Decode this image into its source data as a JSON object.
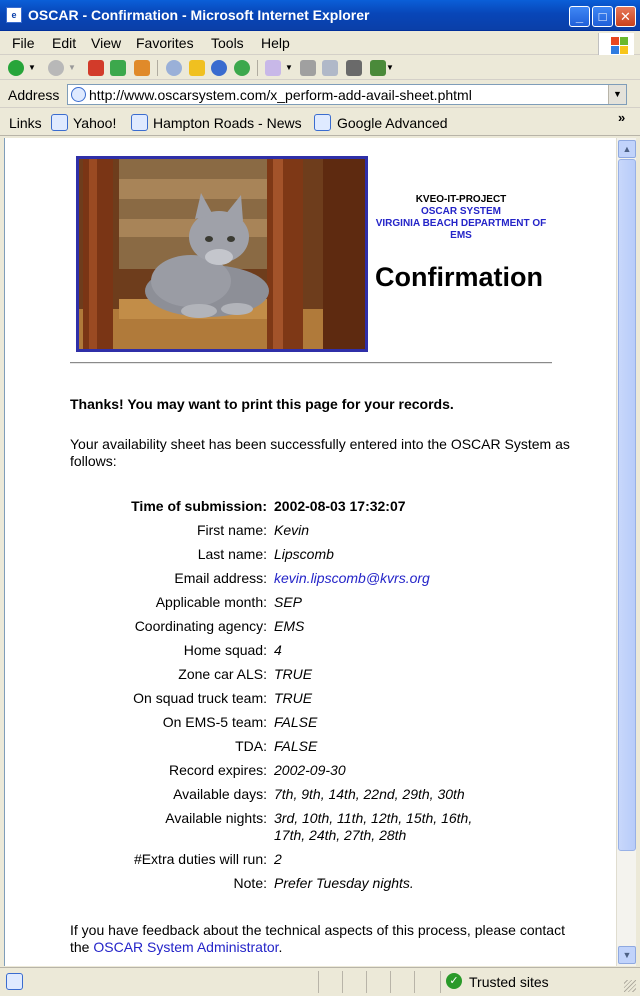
{
  "window": {
    "title": "OSCAR - Confirmation - Microsoft Internet Explorer",
    "icon": "ie-page-icon"
  },
  "menu": [
    "File",
    "Edit",
    "View",
    "Favorites",
    "Tools",
    "Help"
  ],
  "address": {
    "label": "Address",
    "url": "http://www.oscarsystem.com/x_perform-add-avail-sheet.phtml"
  },
  "links_bar": {
    "label": "Links",
    "items": [
      "Yahoo!",
      "Hampton Roads - News",
      "Google Advanced"
    ]
  },
  "page": {
    "org": {
      "line1": "KVEO-IT-PROJECT",
      "line2": "OSCAR SYSTEM",
      "line3": "VIRGINIA BEACH DEPARTMENT OF EMS"
    },
    "heading": "Confirmation",
    "thanks": "Thanks!  You may want to print this page for your records.",
    "intro": "Your availability sheet has been successfully entered into the OSCAR System as follows:",
    "details": [
      {
        "label": "Time of submission:",
        "value": "2002-08-03 17:32:07"
      },
      {
        "label": "First name:",
        "value": "Kevin"
      },
      {
        "label": "Last name:",
        "value": "Lipscomb"
      },
      {
        "label": "Email address:",
        "value": "kevin.lipscomb@kvrs.org"
      },
      {
        "label": "Applicable month:",
        "value": "SEP"
      },
      {
        "label": "Coordinating agency:",
        "value": "EMS"
      },
      {
        "label": "Home squad:",
        "value": "4"
      },
      {
        "label": "Zone car ALS:",
        "value": "TRUE"
      },
      {
        "label": "On squad truck team:",
        "value": "TRUE"
      },
      {
        "label": "On EMS-5 team:",
        "value": "FALSE"
      },
      {
        "label": "TDA:",
        "value": "FALSE"
      },
      {
        "label": "Record expires:",
        "value": "2002-09-30"
      },
      {
        "label": "Available days:",
        "value": "7th, 9th, 14th, 22nd, 29th, 30th"
      },
      {
        "label": "Available nights:",
        "value_line1": "3rd, 10th, 11th, 12th, 15th, 16th,",
        "value_line2": "17th, 24th, 27th, 28th"
      },
      {
        "label": "#Extra duties will run:",
        "value": "2"
      },
      {
        "label": "Note:",
        "value": "Prefer Tuesday nights."
      }
    ],
    "footer_prefix": "If you have feedback about the technical aspects of this process, please contact the ",
    "footer_link": "OSCAR System Administrator",
    "footer_suffix": "."
  },
  "status": {
    "zone": "Trusted sites"
  },
  "colors": {
    "link": "#2424c8",
    "titlebar": "#0846b8",
    "chrome": "#ece9d8",
    "photo_border": "#2f2fa8"
  }
}
